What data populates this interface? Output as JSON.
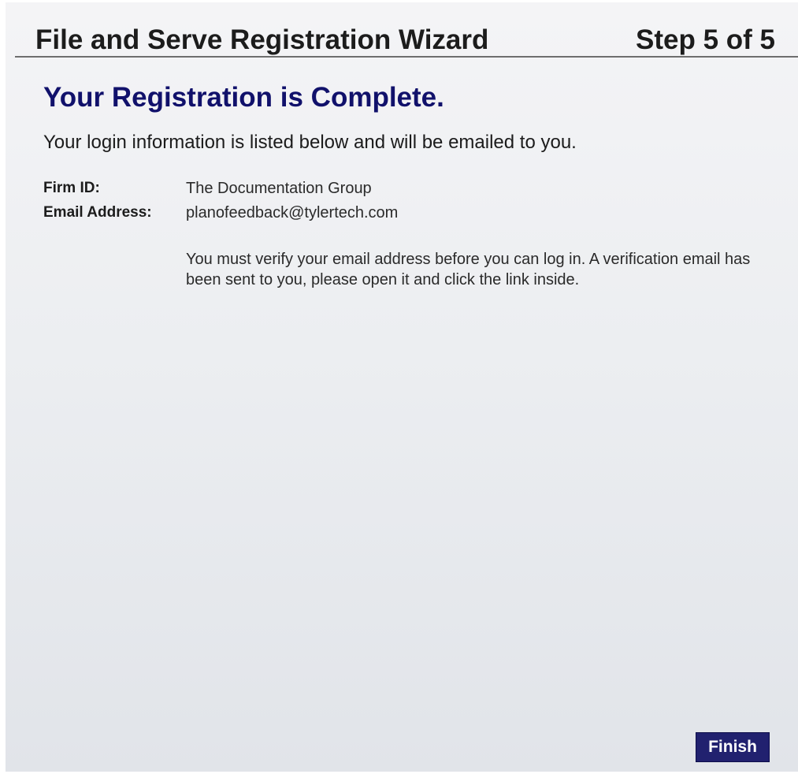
{
  "wizard": {
    "title": "File and Serve Registration Wizard",
    "step": "Step 5 of 5"
  },
  "main": {
    "heading": "Your Registration is Complete.",
    "intro": "Your login information is listed below and will be emailed to you.",
    "fields": [
      {
        "label": "Firm ID:",
        "value": "The Documentation Group"
      },
      {
        "label": "Email Address:",
        "value": "planofeedback@tylertech.com"
      }
    ],
    "verification_note": "You must verify your email address before you can log in.  A verification email has been sent to you, please open it and click the link inside."
  },
  "footer": {
    "finish_label": "Finish"
  },
  "colors": {
    "heading": "#11116b",
    "button_bg": "#21216f",
    "divider": "#6e6e6e"
  }
}
